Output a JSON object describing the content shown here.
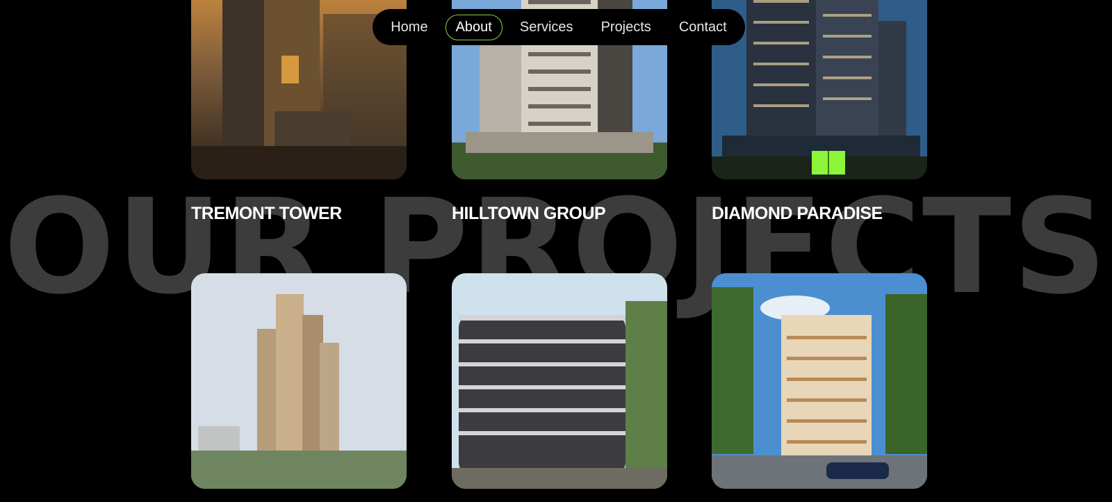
{
  "nav": {
    "items": [
      {
        "label": "Home",
        "active": false
      },
      {
        "label": "About",
        "active": true
      },
      {
        "label": "Services",
        "active": false
      },
      {
        "label": "Projects",
        "active": false
      },
      {
        "label": "Contact",
        "active": false
      }
    ]
  },
  "section": {
    "background_title": "OUR PROJECTS"
  },
  "projects": [
    {
      "name": "TREMONT TOWER"
    },
    {
      "name": "HILLTOWN GROUP"
    },
    {
      "name": "DIAMOND PARADISE"
    }
  ],
  "colors": {
    "accent": "#8cf53a",
    "background": "#000000",
    "bg_title": "#3c3c3c"
  }
}
